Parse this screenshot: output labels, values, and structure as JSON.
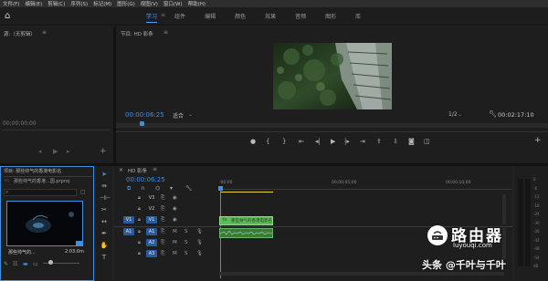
{
  "menu": [
    "文件(F)",
    "编辑(E)",
    "剪辑(C)",
    "序列(S)",
    "标记(M)",
    "图形(G)",
    "视图(V)",
    "窗口(W)",
    "帮助(H)"
  ],
  "workspace_tabs": [
    "学习",
    "组件",
    "编辑",
    "颜色",
    "效果",
    "音频",
    "图形",
    "库"
  ],
  "source": {
    "title": "源:（无剪辑）",
    "timecode": "00;00;00;00"
  },
  "program": {
    "title": "节目: HD 影条",
    "timecode": "00:00:06:25",
    "fit": "适合",
    "resolution": "1/2",
    "duration": "00:02:17:10"
  },
  "project": {
    "title": "项目: 那些帅气的香港电影名",
    "file": "那些帅气的香港...国.prproj",
    "thumb_label": "那些帅气的...",
    "thumb_duration": "2:03:0m"
  },
  "timeline": {
    "title": "HD 影条",
    "timecode": "00:00:06:25",
    "ruler": [
      ":00:00",
      "00;00;05;00",
      "00;00;10;00"
    ],
    "video_tracks": [
      "V3",
      "V2",
      "V1"
    ],
    "audio_tracks": [
      "A1",
      "A2",
      "A3"
    ],
    "source_video": "V1",
    "source_audio": "A1",
    "clip_label": "那些帅气的香港电影名 [V]",
    "clip_label_short": "fx",
    "mute": "M",
    "solo": "S"
  },
  "meters": [
    "0",
    "-6",
    "-12",
    "-18",
    "-24",
    "-30",
    "-36",
    "-42",
    "-48",
    "-54",
    "dB"
  ],
  "watermark": {
    "brand": "路由器",
    "domain": "luyouqi.com",
    "author": "头条 @千叶与千叶"
  },
  "colors": {
    "accent": "#3f8fe3",
    "clip_green": "#5fb85a",
    "in_out_yellow": "#e8d83a"
  }
}
